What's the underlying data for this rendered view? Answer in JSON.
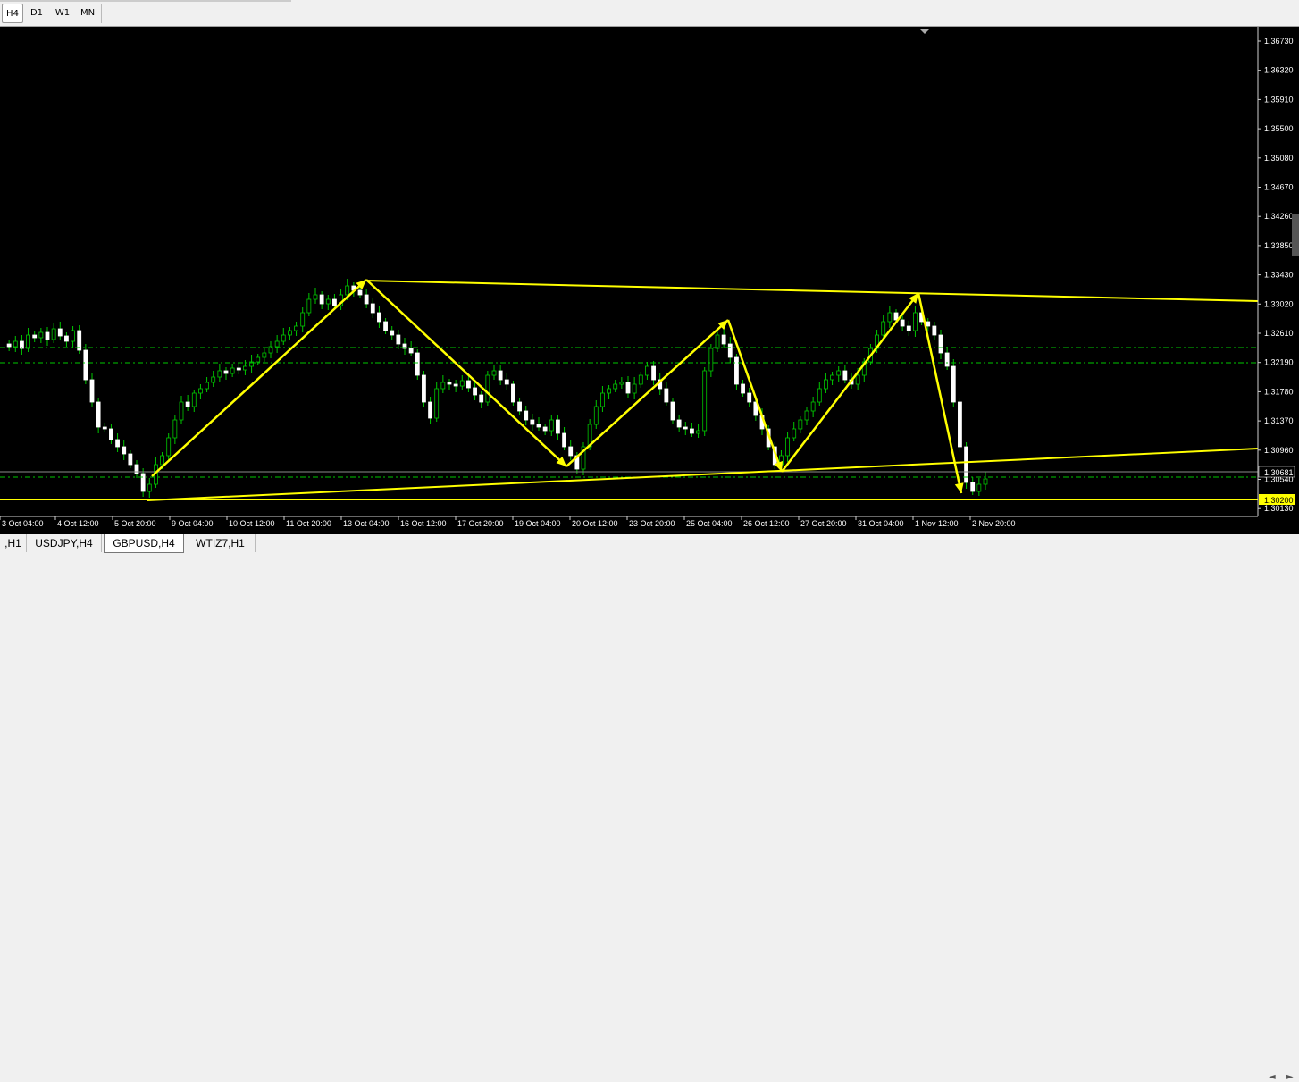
{
  "toolbar": {
    "timeframes": [
      {
        "label": "H4",
        "active": true
      },
      {
        "label": "D1",
        "active": false
      },
      {
        "label": "W1",
        "active": false
      },
      {
        "label": "MN",
        "active": false
      }
    ]
  },
  "chart": {
    "symbol": "GBPUSD,H4",
    "price_axis": [
      "1.36730",
      "1.36320",
      "1.35910",
      "1.35500",
      "1.35080",
      "1.34670",
      "1.34260",
      "1.33850",
      "1.33430",
      "1.33020",
      "1.32610",
      "1.32190",
      "1.31780",
      "1.31370",
      "1.30960",
      "1.30540",
      "1.30130"
    ],
    "time_axis": [
      "3 Oct 04:00",
      "4 Oct 12:00",
      "5 Oct 20:00",
      "9 Oct 04:00",
      "10 Oct 12:00",
      "11 Oct 20:00",
      "13 Oct 04:00",
      "16 Oct 12:00",
      "17 Oct 20:00",
      "19 Oct 04:00",
      "20 Oct 12:00",
      "23 Oct 20:00",
      "25 Oct 04:00",
      "26 Oct 12:00",
      "27 Oct 20:00",
      "31 Oct 04:00",
      "1 Nov 12:00",
      "2 Nov 20:00"
    ],
    "current_price": "1.30681",
    "line_price": "1.30200",
    "colors": {
      "background": "#000000",
      "bull": "#ffffff",
      "bear": "#ffffff",
      "wick": "#00c800",
      "annotation": "#ffff00",
      "grid_level": "#00c800"
    }
  },
  "tabs": [
    {
      "label": ",H1",
      "active": false
    },
    {
      "label": "USDJPY,H4",
      "active": false
    },
    {
      "label": "GBPUSD,H4",
      "active": true
    },
    {
      "label": "WTIZ7,H1",
      "active": false
    }
  ]
}
